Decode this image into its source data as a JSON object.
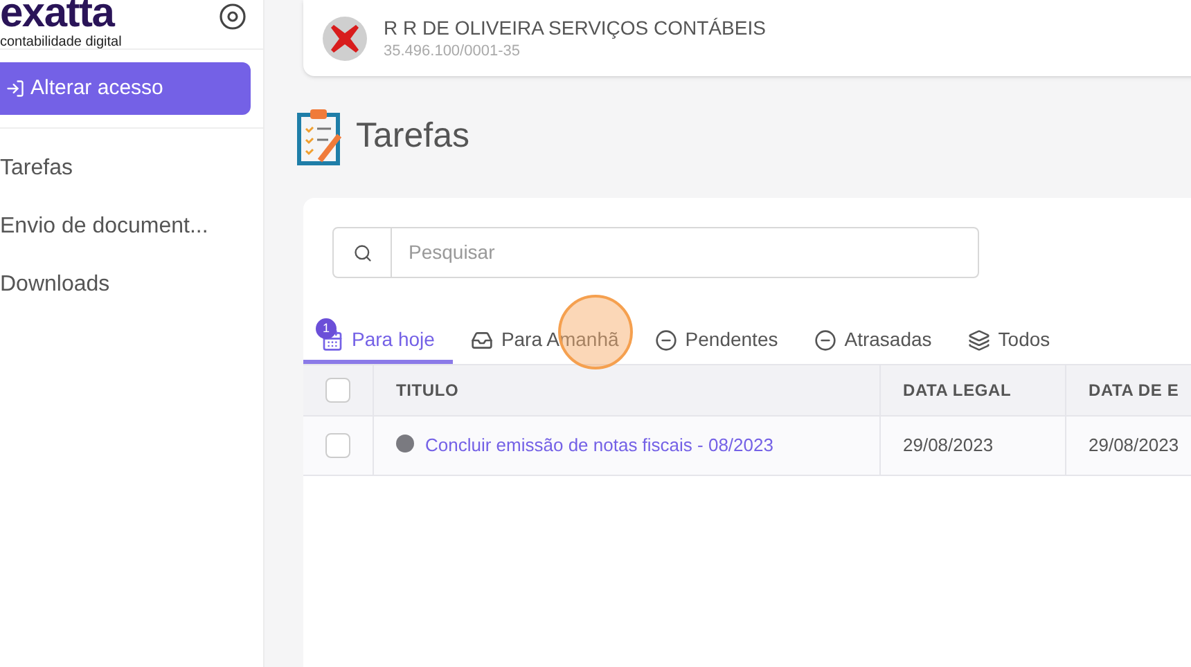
{
  "sidebar": {
    "logo": "exatta",
    "tagline": "contabilidade digital",
    "action_button": "Alterar acesso",
    "items": [
      {
        "label": "Tarefas"
      },
      {
        "label": "Envio de document..."
      },
      {
        "label": "Downloads"
      }
    ]
  },
  "company": {
    "name": "R R DE OLIVEIRA SERVIÇOS CONTÁBEIS",
    "cnpj": "35.496.100/0001-35"
  },
  "page_title": "Tarefas",
  "search": {
    "placeholder": "Pesquisar"
  },
  "tabs": [
    {
      "label": "Para hoje",
      "kind": "today",
      "badge": "1",
      "selected": true
    },
    {
      "label": "Para Amanhã",
      "kind": "inbox",
      "selected": false
    },
    {
      "label": "Pendentes",
      "kind": "minus",
      "selected": false
    },
    {
      "label": "Atrasadas",
      "kind": "minus",
      "selected": false
    },
    {
      "label": "Todos",
      "kind": "layers",
      "selected": false
    }
  ],
  "table": {
    "select_all_checked": false,
    "columns": [
      "TITULO",
      "DATA LEGAL",
      "DATA DE E"
    ],
    "rows": [
      {
        "checked": false,
        "color": "#7a7a80",
        "cells": [
          "Concluir emissão de notas fiscais - 08/2023",
          "29/08/2023",
          "29/08/2023"
        ]
      }
    ]
  }
}
